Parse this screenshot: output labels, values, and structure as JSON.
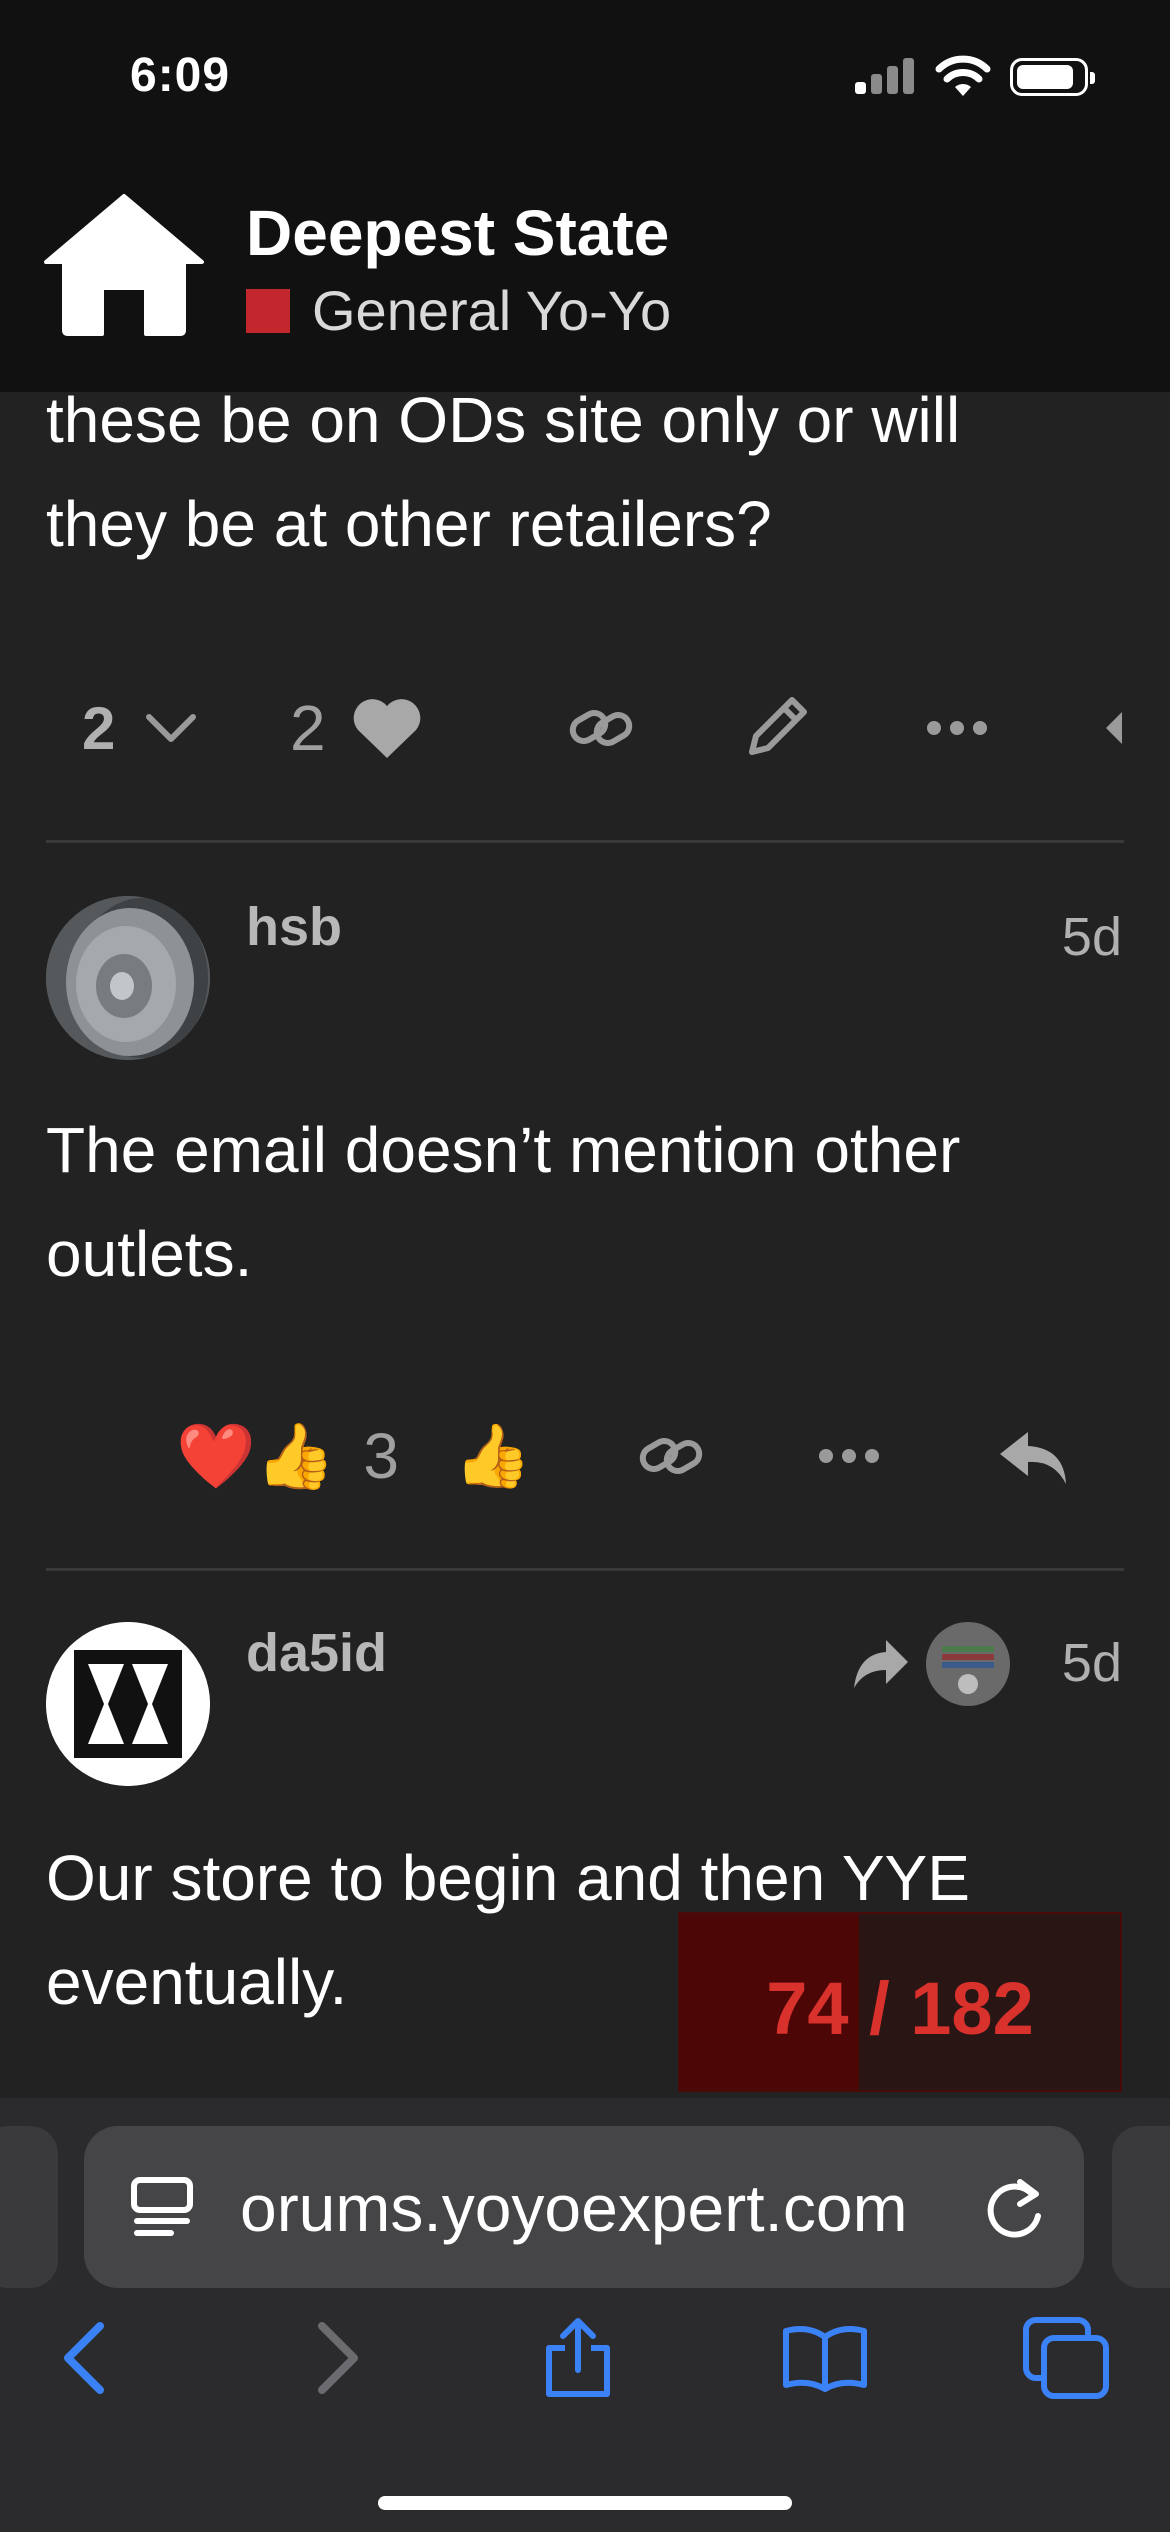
{
  "status_bar": {
    "time": "6:09"
  },
  "header": {
    "site_title": "Deepest State",
    "category": "General Yo-Yo",
    "category_color": "#c1272d"
  },
  "posts": [
    {
      "text_lines": [
        "these be on ODs site only or will",
        "they be at other retailers?"
      ],
      "actions": {
        "replies": "2",
        "likes": "2"
      }
    },
    {
      "username": "hsb",
      "time": "5d",
      "text_lines": [
        "The email doesn’t mention other",
        "outlets."
      ],
      "reactions": {
        "emoji": "❤️👍",
        "count": "3",
        "quick_react": "👍"
      }
    },
    {
      "username": "da5id",
      "time": "5d",
      "text_lines": [
        "Our store to begin and then YYE",
        "eventually."
      ]
    }
  ],
  "progress": {
    "current": "74",
    "separator": " / ",
    "total": "182",
    "fraction": 0.406
  },
  "browser": {
    "url": "orums.yoyoexpert.com"
  },
  "colors": {
    "background": "#222222",
    "header": "#111111",
    "toolbar_blue": "#3b82f6",
    "progress_red": "#d9312c"
  }
}
